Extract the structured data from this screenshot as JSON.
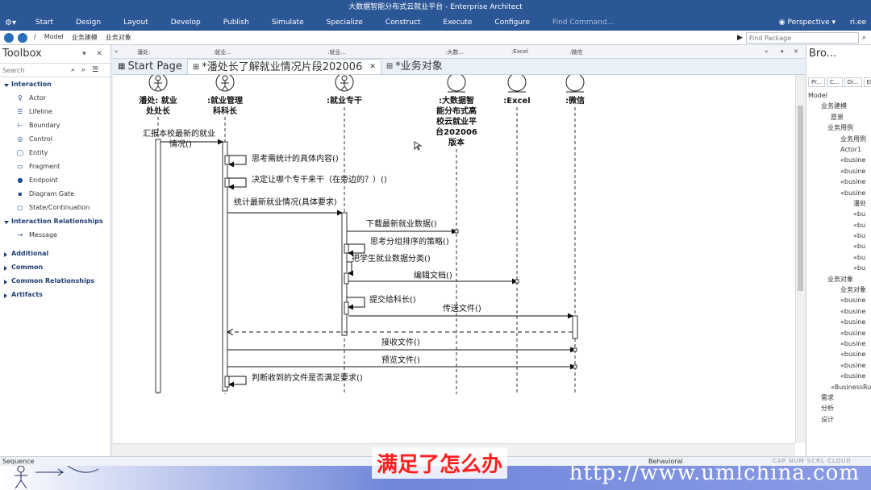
{
  "window": {
    "title": "大数据智能分布式云就业平台 - Enterprise Architect"
  },
  "menu": {
    "items": [
      "Start",
      "Design",
      "Layout",
      "Develop",
      "Publish",
      "Simulate",
      "Specialize",
      "Construct",
      "Execute",
      "Configure"
    ],
    "command_placeholder": "Find Command...",
    "perspective": "Perspective",
    "user": "ri.ee"
  },
  "nav": {
    "crumbs": [
      "/",
      "Model",
      "业务建模",
      "业务对象"
    ],
    "find_placeholder": "Find Package"
  },
  "toolbox": {
    "title": "Toolbox",
    "search_placeholder": "Search",
    "interaction_title": "Interaction",
    "interaction_items": [
      {
        "label": "Actor",
        "icon": "actor-icon"
      },
      {
        "label": "Lifeline",
        "icon": "lifeline-icon"
      },
      {
        "label": "Boundary",
        "icon": "boundary-icon"
      },
      {
        "label": "Control",
        "icon": "control-icon"
      },
      {
        "label": "Entity",
        "icon": "entity-icon"
      },
      {
        "label": "Fragment",
        "icon": "fragment-icon"
      },
      {
        "label": "Endpoint",
        "icon": "endpoint-icon"
      },
      {
        "label": "Diagram Gate",
        "icon": "diagram-gate-icon"
      },
      {
        "label": "State/Continuation",
        "icon": "state-icon"
      }
    ],
    "relationships_title": "Interaction Relationships",
    "relationship_items": [
      {
        "label": "Message",
        "icon": "message-arrow-icon"
      }
    ],
    "collapsed": [
      "Additional",
      "Common",
      "Common Relationships",
      "Artifacts"
    ]
  },
  "lanes": [
    "潘处:",
    ":就业...",
    ":就业...",
    ":大数...",
    ":Excel",
    ":微信"
  ],
  "tabs": [
    {
      "label": "Start Page",
      "active": false
    },
    {
      "label": "*潘处长了解就业情况片段202006",
      "active": true
    },
    {
      "label": "*业务对象",
      "active": false
    }
  ],
  "diagram": {
    "lifelines": [
      {
        "name": "潘处: 就业处处长",
        "kind": "actor"
      },
      {
        "name": ":就业管理科科长",
        "kind": "actor"
      },
      {
        "name": ":就业专干",
        "kind": "actor"
      },
      {
        "name": ":大数据智能分布式高校云就业平台202006版本",
        "kind": "entity"
      },
      {
        "name": ":Excel",
        "kind": "entity"
      },
      {
        "name": ":微信",
        "kind": "entity"
      }
    ],
    "messages": [
      "汇报本校最新的就业情况()",
      "思考需统计的具体内容()",
      "决定让哪个专干来干（在旁边的？）()",
      "统计最新就业情况(具体要求)",
      "下载最新就业数据()",
      "思考分组排序的策略()",
      "把学生就业数据分类()",
      "编辑文档()",
      "提交给科长()",
      "传送文件()",
      "接收文件()",
      "预览文件()",
      "判断收到的文件是否满足要求()"
    ]
  },
  "browser": {
    "title": "Bro...",
    "tabs": [
      "Pr...",
      "C...",
      "Di...",
      "El..."
    ],
    "tree": [
      "Model",
      "业务建模",
      "愿景",
      "业务用例",
      "业务用例",
      "Actor1",
      "«busine",
      "«busine",
      "«busine",
      "«busine",
      "潘处",
      "«bu",
      "«bu",
      "«bu",
      "«bu",
      "«bu",
      "«bu",
      "业务对象",
      "业务对象",
      "«busine",
      "«busine",
      "«busine",
      "«busine",
      "«busine",
      "«busine",
      "«busine",
      "«busine",
      "«BusinessRu",
      "需求",
      "分析",
      "设计"
    ]
  },
  "status": {
    "mode": "Sequence",
    "view": "Behavioral",
    "keys": [
      "CAP",
      "NUM",
      "SCRL",
      "CLOUD"
    ]
  },
  "overlay": {
    "subtitle": "满足了怎么办",
    "watermark": "http://www.umlchina.com"
  }
}
